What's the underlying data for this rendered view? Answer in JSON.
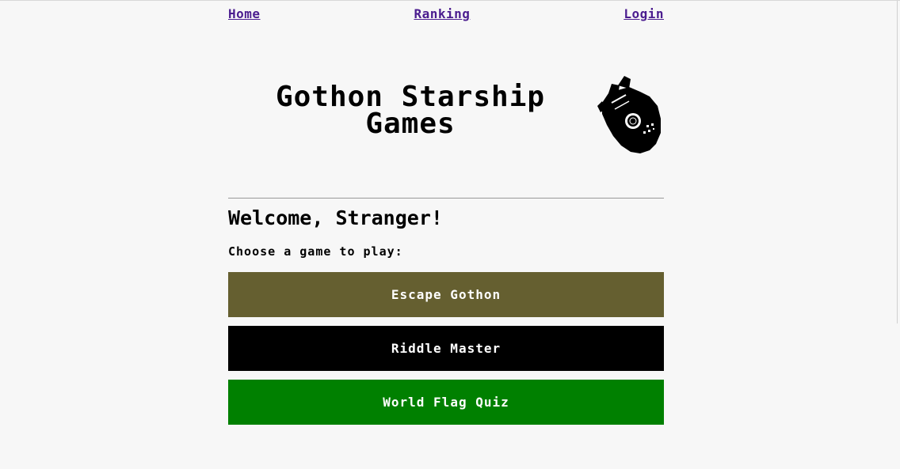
{
  "nav": {
    "home_label": "Home",
    "ranking_label": "Ranking",
    "login_label": "Login",
    "link_color": "#4b1d8f"
  },
  "header": {
    "title": "Gothon Starship Games",
    "logo_icon": "starship-icon"
  },
  "main": {
    "welcome": "Welcome, Stranger!",
    "prompt": "Choose a game to play:",
    "games": [
      {
        "label": "Escape Gothon",
        "color": "#655f30"
      },
      {
        "label": "Riddle Master",
        "color": "#000000"
      },
      {
        "label": "World Flag Quiz",
        "color": "#008000"
      }
    ]
  }
}
